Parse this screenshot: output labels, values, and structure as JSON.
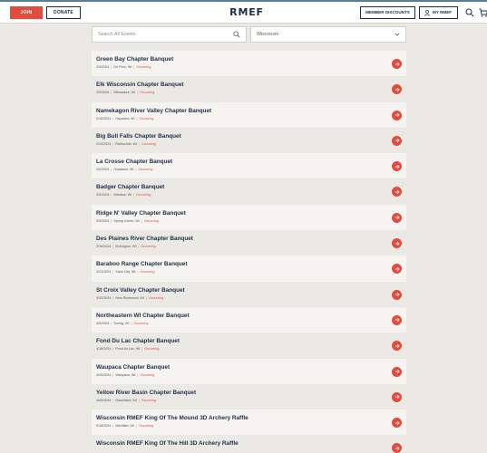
{
  "header": {
    "join_label": "JOIN",
    "donate_label": "DONATE",
    "logo_text": "RMEF",
    "member_discounts_label": "MEMBER DISCOUNTS",
    "my_rmef_label": "MY RMEF",
    "icons": [
      "user-icon",
      "search-icon",
      "cart-icon"
    ],
    "accent_color": "#e54b3c",
    "navy_color": "#1c2e4a"
  },
  "filters": {
    "search_placeholder": "Search All Events",
    "state_selected": "Wisconsin"
  },
  "events": [
    {
      "name": "Green Bay Chapter Banquet",
      "date": "2/3/2024",
      "location": "De Pere, WI",
      "status": "Occurring"
    },
    {
      "name": "Elk Wisconsin Chapter Banquet",
      "date": "2/9/2024",
      "location": "Milwaukee, WI",
      "status": "Occurring"
    },
    {
      "name": "Namekagon River Valley Chapter Banquet",
      "date": "2/10/2024",
      "location": "Hayward, WI",
      "status": "Occurring"
    },
    {
      "name": "Big Bull Falls Chapter Banquet",
      "date": "2/24/2024",
      "location": "Rothschild, WI",
      "status": "Occurring"
    },
    {
      "name": "La Crosse Chapter Banquet",
      "date": "3/2/2024",
      "location": "Onalaska, WI",
      "status": "Occurring"
    },
    {
      "name": "Badger Chapter Banquet",
      "date": "3/2/2024",
      "location": "Windsor, WI",
      "status": "Occurring"
    },
    {
      "name": "Ridge N' Valley Chapter Banquet",
      "date": "3/9/2024",
      "location": "Spring Green, WI",
      "status": "Occurring"
    },
    {
      "name": "Des Plaines River Chapter Banquet",
      "date": "3/16/2024",
      "location": "Burlington, WI",
      "status": "Occurring"
    },
    {
      "name": "Baraboo Range Chapter Banquet",
      "date": "3/21/2024",
      "location": "Sauk City, WI",
      "status": "Occurring"
    },
    {
      "name": "St Croix Valley Chapter Banquet",
      "date": "3/23/2024",
      "location": "New Richmond, WI",
      "status": "Occurring"
    },
    {
      "name": "Northeastern WI Chapter Banquet",
      "date": "4/9/2024",
      "location": "Suring, WI",
      "status": "Occurring"
    },
    {
      "name": "Fond Du Lac Chapter Banquet",
      "date": "4/18/2024",
      "location": "Fond du Lac, WI",
      "status": "Occurring"
    },
    {
      "name": "Waupaca Chapter Banquet",
      "date": "4/20/2024",
      "location": "Waupaca, WI",
      "status": "Occurring"
    },
    {
      "name": "Yellow River Basin Chapter Banquet",
      "date": "4/25/2024",
      "location": "Marshfield, WI",
      "status": "Occurring"
    },
    {
      "name": "Wisconsin RMEF King Of The Mound 3D Archery Raffle",
      "date": "5/18/2024",
      "location": "Merrillan, WI",
      "status": "Occurring"
    },
    {
      "name": "Wisconsin RMEF King Of The Hill 3D Archery Raffle",
      "date": "",
      "location": "",
      "status": ""
    }
  ]
}
